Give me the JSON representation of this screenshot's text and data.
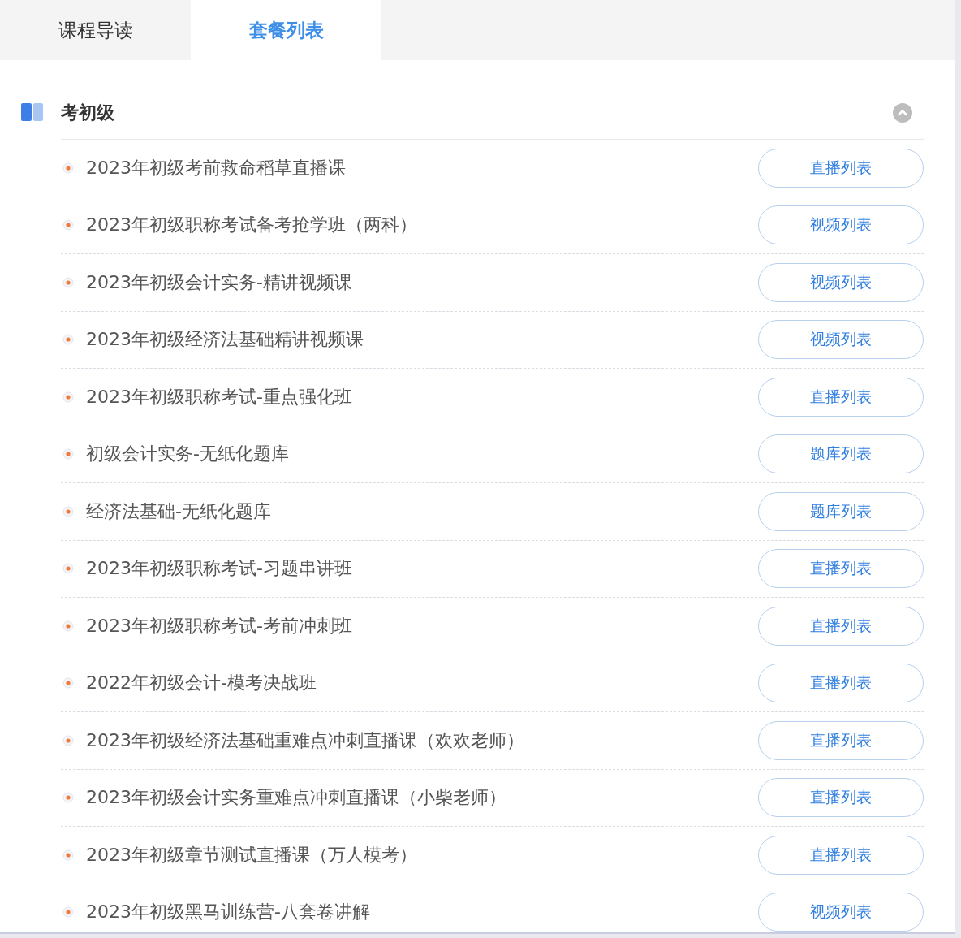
{
  "tabs": [
    {
      "label": "课程导读",
      "selected": false
    },
    {
      "label": "套餐列表",
      "selected": true
    }
  ],
  "section": {
    "title": "考初级",
    "expanded": true,
    "items": [
      {
        "title": "2023年初级考前救命稻草直播课",
        "button": "直播列表"
      },
      {
        "title": "2023年初级职称考试备考抢学班（两科）",
        "button": "视频列表"
      },
      {
        "title": "2023年初级会计实务-精讲视频课",
        "button": "视频列表"
      },
      {
        "title": "2023年初级经济法基础精讲视频课",
        "button": "视频列表"
      },
      {
        "title": "2023年初级职称考试-重点强化班",
        "button": "直播列表"
      },
      {
        "title": "初级会计实务-无纸化题库",
        "button": "题库列表"
      },
      {
        "title": "经济法基础-无纸化题库",
        "button": "题库列表"
      },
      {
        "title": "2023年初级职称考试-习题串讲班",
        "button": "直播列表"
      },
      {
        "title": "2023年初级职称考试-考前冲刺班",
        "button": "直播列表"
      },
      {
        "title": "2022年初级会计-模考决战班",
        "button": "直播列表"
      },
      {
        "title": "2023年初级经济法基础重难点冲刺直播课（欢欢老师）",
        "button": "直播列表"
      },
      {
        "title": "2023年初级会计实务重难点冲刺直播课（小柴老师）",
        "button": "直播列表"
      },
      {
        "title": "2023年初级章节测试直播课（万人模考）",
        "button": "直播列表"
      },
      {
        "title": "2023年初级黑马训练营-八套卷讲解",
        "button": "视频列表"
      }
    ]
  }
}
